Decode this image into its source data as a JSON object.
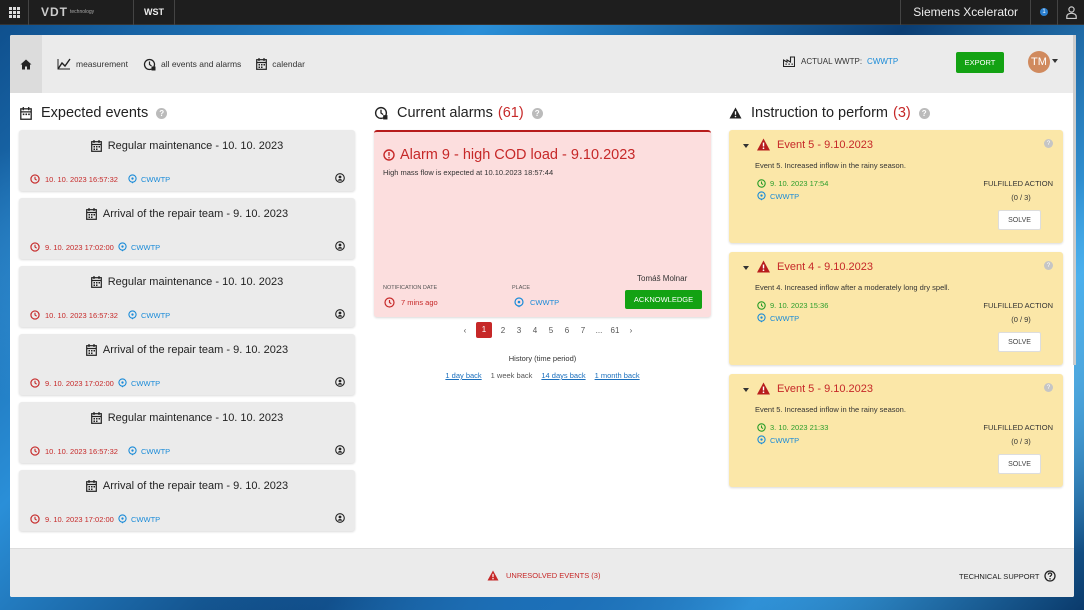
{
  "topbar": {
    "brand": "VDT",
    "brand_sub": "technology",
    "app": "WST",
    "product": "Siemens Xcelerator",
    "notification_count": "1"
  },
  "nav": {
    "measurement": "measurement",
    "events": "all events and alarms",
    "calendar": "calendar",
    "wwtp_label": "ACTUAL WWTP:",
    "wwtp_value": "CWWTP",
    "export": "EXPORT",
    "avatar_initials": "TM"
  },
  "expected": {
    "title": "Expected events",
    "items": [
      {
        "title": "Regular maintenance - 10. 10. 2023",
        "time": "10. 10. 2023 16:57:32",
        "place": "CWWTP"
      },
      {
        "title": "Arrival of the repair team - 9. 10. 2023",
        "time": "9. 10. 2023 17:02:00",
        "place": "CWWTP"
      },
      {
        "title": "Regular maintenance - 10. 10. 2023",
        "time": "10. 10. 2023 16:57:32",
        "place": "CWWTP"
      },
      {
        "title": "Arrival of the repair team - 9. 10. 2023",
        "time": "9. 10. 2023 17:02:00",
        "place": "CWWTP"
      },
      {
        "title": "Regular maintenance - 10. 10. 2023",
        "time": "10. 10. 2023 16:57:32",
        "place": "CWWTP"
      },
      {
        "title": "Arrival of the repair team - 9. 10. 2023",
        "time": "9. 10. 2023 17:02:00",
        "place": "CWWTP"
      }
    ]
  },
  "alarms": {
    "title": "Current alarms",
    "count": "(61)",
    "current": {
      "title": "Alarm 9 - high COD load - 9.10.2023",
      "description": "High mass flow is expected at 10.10.2023 18:57:44",
      "notification_label": "NOTIFICATION DATE",
      "notification_value": "7 mins ago",
      "place_label": "PLACE",
      "place_value": "CWWTP",
      "user": "Tomáš Molnar",
      "acknowledge": "ACKNOWLEDGE"
    },
    "pagination": {
      "pages": [
        "1",
        "2",
        "3",
        "4",
        "5",
        "6",
        "7",
        "...",
        "61"
      ],
      "active": "1"
    },
    "history": {
      "label": "History (time period)",
      "options": [
        "1 day back",
        "1 week back",
        "14 days back",
        "1 month back"
      ]
    }
  },
  "instructions": {
    "title": "Instruction to perform",
    "count": "(3)",
    "items": [
      {
        "title": "Event 5 - 9.10.2023",
        "description": "Event 5. Increased inflow in the rainy season.",
        "time": "9. 10. 2023 17:54",
        "place": "CWWTP",
        "fulfilled_label": "FULFILLED ACTION",
        "fulfilled_value": "(0 / 3)",
        "solve": "SOLVE"
      },
      {
        "title": "Event 4 - 9.10.2023",
        "description": "Event 4. Increased inflow after a moderately long dry spell.",
        "time": "9. 10. 2023 15:36",
        "place": "CWWTP",
        "fulfilled_label": "FULFILLED ACTION",
        "fulfilled_value": "(0 / 9)",
        "solve": "SOLVE"
      },
      {
        "title": "Event 5 - 9.10.2023",
        "description": "Event 5. Increased inflow in the rainy season.",
        "time": "3. 10. 2023 21:33",
        "place": "CWWTP",
        "fulfilled_label": "FULFILLED ACTION",
        "fulfilled_value": "(0 / 3)",
        "solve": "SOLVE"
      }
    ]
  },
  "footer": {
    "unresolved": "UNRESOLVED EVENTS (3)",
    "support": "TECHNICAL SUPPORT"
  },
  "colors": {
    "accent_red": "#c62828",
    "accent_green": "#13a213",
    "link_blue": "#1a8bd8",
    "alarm_bg": "#fcdede",
    "instruction_bg": "#fbe7a8"
  },
  "icons": [
    "apps-grid-icon",
    "notification-icon",
    "user-icon",
    "home-icon",
    "measurement-icon",
    "events-icon",
    "calendar-icon",
    "building-icon",
    "clock-icon",
    "place-icon",
    "person-icon",
    "warning-icon",
    "help-icon",
    "alert-circle-icon"
  ]
}
